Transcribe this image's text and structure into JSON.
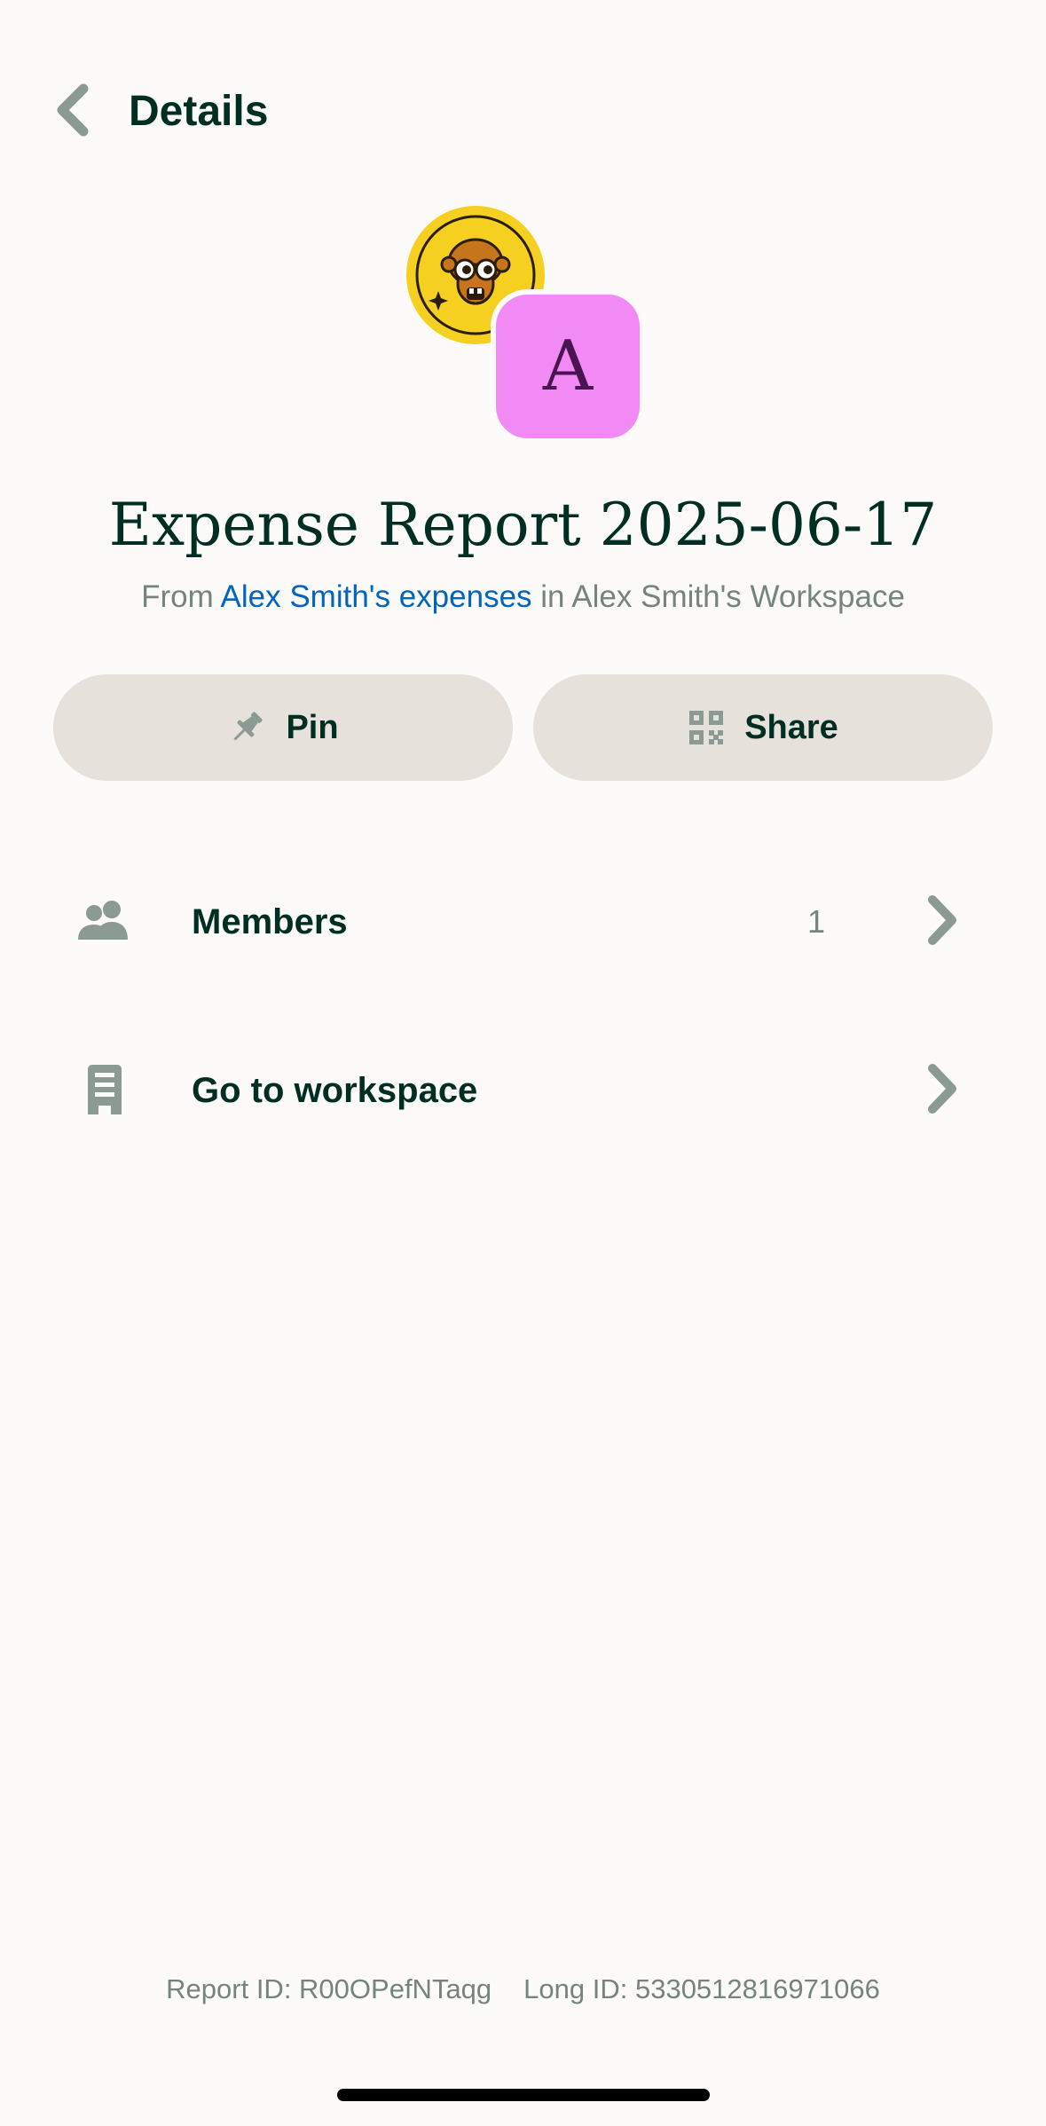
{
  "header": {
    "title": "Details",
    "back_icon": "chevron-left-icon"
  },
  "avatars": {
    "primary_icon": "monkey-avatar-icon",
    "primary_color": "#f5d020",
    "secondary_letter": "A",
    "secondary_color": "#f28af5"
  },
  "report": {
    "title": "Expense Report 2025-06-17",
    "subtitle_prefix": "From ",
    "subtitle_link": "Alex Smith's expenses",
    "subtitle_suffix": " in Alex Smith's Workspace"
  },
  "actions": {
    "pin_label": "Pin",
    "pin_icon": "pin-icon",
    "share_label": "Share",
    "share_icon": "qr-code-icon"
  },
  "menu": {
    "members": {
      "label": "Members",
      "count": "1",
      "icon": "users-icon"
    },
    "workspace": {
      "label": "Go to workspace",
      "icon": "building-icon"
    }
  },
  "footer": {
    "report_id": "Report ID: R00OPefNTaqg",
    "long_id": "Long ID: 5330512816971066"
  },
  "colors": {
    "background": "#fcfbf9",
    "text_primary": "#002e22",
    "text_secondary": "#76847e",
    "link": "#0164bf",
    "button_bg": "#e6e1da",
    "icon": "#8c9a94"
  }
}
